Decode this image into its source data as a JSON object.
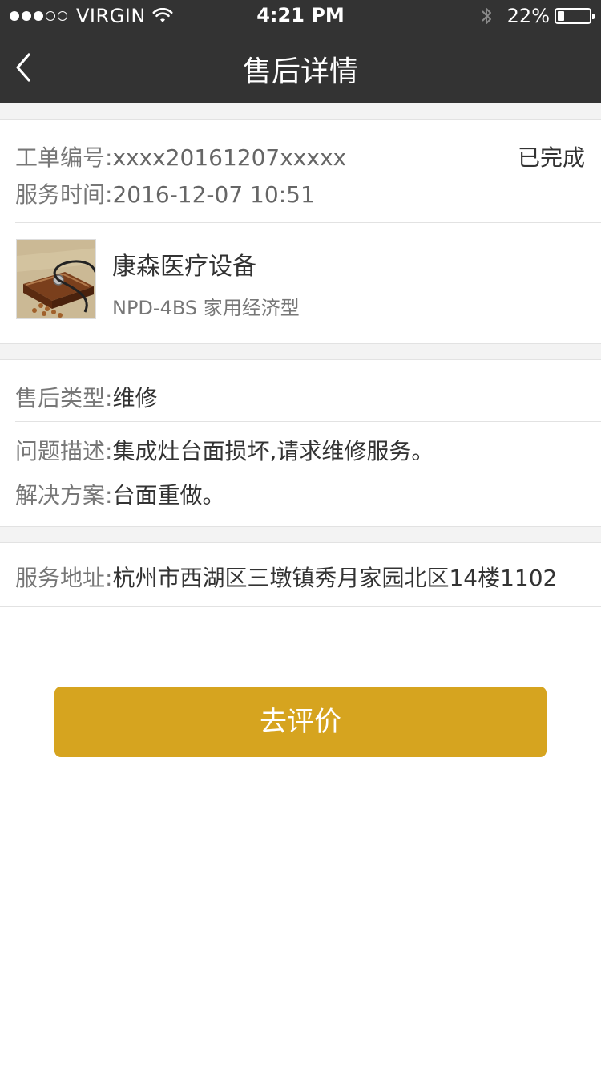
{
  "status_bar": {
    "carrier": "VIRGIN",
    "signal_bars_filled": 3,
    "signal_bars_total": 5,
    "time": "4:21 PM",
    "battery_percent_text": "22%",
    "battery_level": 0.22
  },
  "nav": {
    "back_icon": "chevron-left-icon",
    "title": "售后详情"
  },
  "order": {
    "number_label": "工单编号:",
    "number_value": "xxxx20161207xxxxx",
    "status": "已完成",
    "time_label": "服务时间:",
    "time_value": "2016-12-07  10:51"
  },
  "product": {
    "name": "康森医疗设备",
    "model": "NPD-4BS 家用经济型"
  },
  "after_sale": {
    "type_label": "售后类型:",
    "type_value": "维修",
    "problem_label": "问题描述:",
    "problem_value": "集成灶台面损坏,请求维修服务。",
    "solution_label": "解决方案:",
    "solution_value": "台面重做。"
  },
  "address": {
    "label": "服务地址:",
    "value": "杭州市西湖区三墩镇秀月家园北区14楼1102"
  },
  "action": {
    "evaluate_label": "去评价"
  },
  "colors": {
    "topbar": "#333333",
    "accent": "#d6a41f",
    "background": "#f3f3f3"
  }
}
